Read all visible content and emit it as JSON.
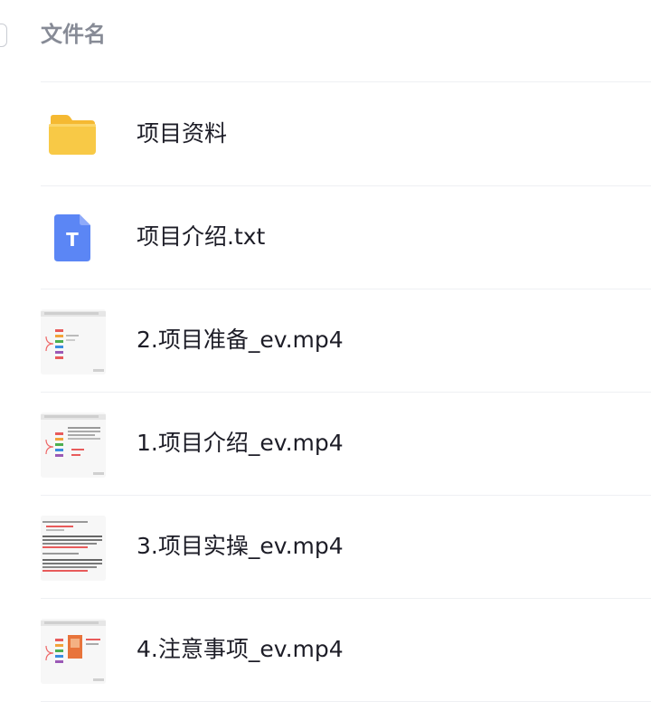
{
  "header": {
    "title": "文件名"
  },
  "files": [
    {
      "name": "项目资料",
      "type_icon": "folder-icon"
    },
    {
      "name": "项目介绍.txt",
      "type_icon": "txt-file-icon",
      "icon_letter": "T"
    },
    {
      "name": "2.项目准备_ev.mp4",
      "type_icon": "video-thumbnail"
    },
    {
      "name": "1.项目介绍_ev.mp4",
      "type_icon": "video-thumbnail"
    },
    {
      "name": "3.项目实操_ev.mp4",
      "type_icon": "video-thumbnail"
    },
    {
      "name": "4.注意事项_ev.mp4",
      "type_icon": "video-thumbnail"
    }
  ],
  "colors": {
    "folder": "#f8c946",
    "txt_icon": "#5b86f5",
    "header_text": "#878b96",
    "divider": "#eef0f3"
  }
}
